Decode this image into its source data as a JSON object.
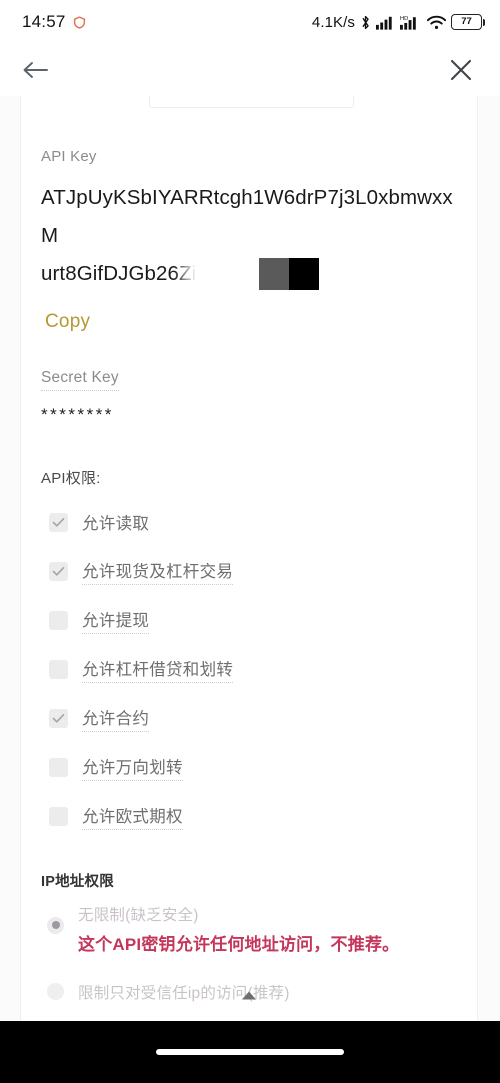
{
  "status_bar": {
    "time": "14:57",
    "shield_icon": "shield-icon",
    "network_speed": "4.1K/s",
    "bluetooth_icon": "bluetooth-icon",
    "signal_icon": "signal-bars-icon",
    "hd_label": "HD",
    "signal2_icon": "signal-bars-icon",
    "wifi_icon": "wifi-icon",
    "battery_level": "77"
  },
  "nav": {
    "back_icon": "back-arrow-icon",
    "close_icon": "close-icon"
  },
  "api_key": {
    "label": "API Key",
    "value_line1": "ATJpUyKSbIYARRtcgh1W6drP7j3L0xbmwxxM",
    "value_line2": "urt8GifDJGb26Zii",
    "copy_label": "Copy"
  },
  "secret_key": {
    "label": "Secret Key",
    "value": "********"
  },
  "permissions": {
    "title": "API权限:",
    "items": [
      {
        "label": "允许读取",
        "checked": true,
        "underline": false
      },
      {
        "label": "允许现货及杠杆交易",
        "checked": true,
        "underline": true
      },
      {
        "label": "允许提现",
        "checked": false,
        "underline": true
      },
      {
        "label": "允许杠杆借贷和划转",
        "checked": false,
        "underline": true
      },
      {
        "label": "允许合约",
        "checked": true,
        "underline": true
      },
      {
        "label": "允许万向划转",
        "checked": false,
        "underline": true
      },
      {
        "label": "允许欧式期权",
        "checked": false,
        "underline": true
      }
    ]
  },
  "ip_access": {
    "title": "IP地址权限",
    "option_unrestricted": "无限制(缺乏安全)",
    "warning": "这个API密钥允许任何地址访问，不推荐。",
    "option_restricted": "限制只对受信任ip的访问(推荐)"
  },
  "footer": {
    "scroll_top_icon": "triangle-up-icon",
    "home_indicator": "home-indicator"
  },
  "colors": {
    "accent_copy": "#b49a34",
    "warning": "#c4365a",
    "checkbox_bg": "#ececec",
    "background": "#ffffff"
  }
}
